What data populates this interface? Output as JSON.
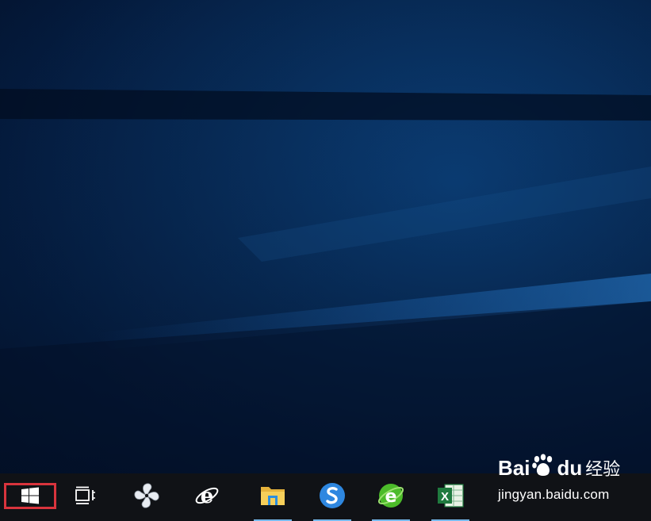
{
  "desktop": {
    "wallpaper": "windows-10-hero-blue"
  },
  "taskbar": {
    "start_button": {
      "icon": "windows-logo-icon",
      "highlighted": true,
      "highlight_color": "#d9343d"
    },
    "task_view": {
      "icon": "task-view-icon"
    },
    "pinned_apps": [
      {
        "icon": "pinwheel-app-icon",
        "running": false
      },
      {
        "icon": "internet-explorer-icon",
        "running": false
      },
      {
        "icon": "file-explorer-icon",
        "running": true
      },
      {
        "icon": "sogou-browser-icon",
        "running": true
      },
      {
        "icon": "360-browser-icon",
        "running": true
      },
      {
        "icon": "excel-icon",
        "running": true
      }
    ],
    "accent_color": "#76b9ed"
  },
  "watermark": {
    "brand_left": "Bai",
    "brand_right": "du",
    "product": "经验",
    "url": "jingyan.baidu.com"
  }
}
